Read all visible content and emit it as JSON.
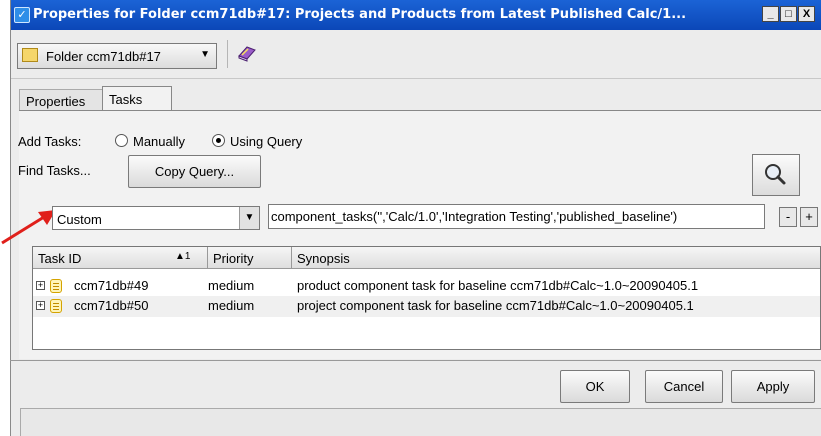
{
  "window": {
    "title": "Properties for Folder ccm71db#17: Projects and Products from Latest Published Calc/1...",
    "minimize_label": "_",
    "maximize_label": "□",
    "close_label": "X"
  },
  "toolbar": {
    "folder_selector": "Folder ccm71db#17"
  },
  "tabs": [
    {
      "label": "Properties",
      "active": false
    },
    {
      "label": "Tasks",
      "active": true
    }
  ],
  "tasks_panel": {
    "add_tasks_label": "Add Tasks:",
    "option_manually": "Manually",
    "option_using_query": "Using Query",
    "selected_option": "Using Query",
    "find_tasks_label": "Find Tasks...",
    "copy_query_label": "Copy Query...",
    "query_type": "Custom",
    "query_text": "component_tasks('','Calc/1.0','Integration Testing','published_baseline')",
    "minus_label": "-",
    "plus_label": "+"
  },
  "table": {
    "columns": [
      "Task ID",
      "Priority",
      "Synopsis"
    ],
    "sort_indicator": "▲1",
    "rows": [
      {
        "task_id": "ccm71db#49",
        "priority": "medium",
        "synopsis": "product component task for baseline ccm71db#Calc~1.0~20090405.1"
      },
      {
        "task_id": "ccm71db#50",
        "priority": "medium",
        "synopsis": "project component task for baseline ccm71db#Calc~1.0~20090405.1"
      }
    ]
  },
  "buttons": {
    "ok": "OK",
    "cancel": "Cancel",
    "apply": "Apply"
  },
  "colors": {
    "titlebar": "#0b47b8",
    "annotation_arrow": "#e0201b"
  }
}
